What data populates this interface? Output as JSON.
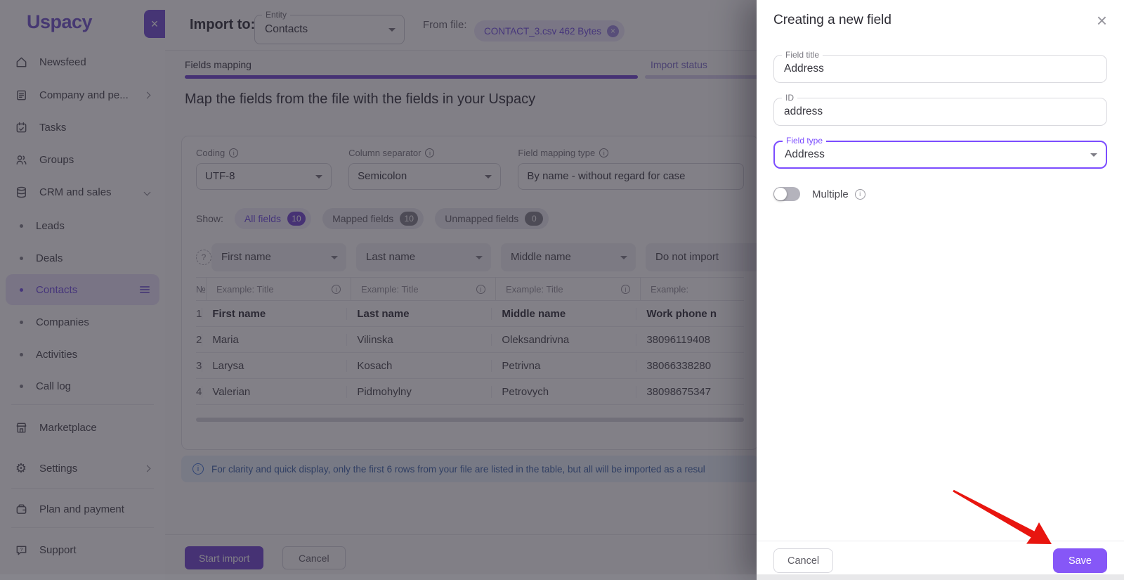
{
  "accent_color": "#7b52d6",
  "save_color": "#8657f7",
  "sidebar": {
    "logo": "Uspacy",
    "items": [
      {
        "label": "Newsfeed",
        "icon": "home-icon"
      },
      {
        "label": "Company and pe...",
        "icon": "building-icon"
      },
      {
        "label": "Tasks",
        "icon": "calendar-icon"
      },
      {
        "label": "Groups",
        "icon": "users-icon"
      },
      {
        "label": "CRM and sales",
        "icon": "database-icon"
      },
      {
        "label": "Leads"
      },
      {
        "label": "Deals"
      },
      {
        "label": "Contacts"
      },
      {
        "label": "Companies"
      },
      {
        "label": "Activities"
      },
      {
        "label": "Call log"
      },
      {
        "label": "Marketplace",
        "icon": "store-icon"
      },
      {
        "label": "Settings",
        "icon": "gear-icon"
      },
      {
        "label": "Plan and payment",
        "icon": "wallet-icon"
      },
      {
        "label": "Support",
        "icon": "help-chat-icon"
      }
    ]
  },
  "topbar": {
    "title": "Import to:",
    "entity_label": "Entity",
    "entity_value": "Contacts",
    "from_file_label": "From file:",
    "file_chip": "CONTACT_3.csv 462 Bytes"
  },
  "tabs": {
    "fields_mapping": "Fields mapping",
    "import_status": "Import status"
  },
  "heading": "Map the fields from the file with the fields in your Uspacy",
  "settings": {
    "coding_label": "Coding",
    "coding_value": "UTF-8",
    "separator_label": "Column separator",
    "separator_value": "Semicolon",
    "mapping_label": "Field mapping type",
    "mapping_value": "By name - without regard for case"
  },
  "filters": {
    "show_label": "Show:",
    "chips": [
      {
        "label": "All fields",
        "count": "10"
      },
      {
        "label": "Mapped fields",
        "count": "10"
      },
      {
        "label": "Unmapped fields",
        "count": "0"
      }
    ]
  },
  "table": {
    "column_selects": [
      "First name",
      "Last name",
      "Middle name",
      "Do not import"
    ],
    "row_number_header": "№",
    "example_placeholder": "Example: Title",
    "example_short": "Example:",
    "rows": [
      {
        "num": "1",
        "cells": [
          "First name",
          "Last name",
          "Middle name",
          "Work phone n"
        ]
      },
      {
        "num": "2",
        "cells": [
          "Maria",
          "Vilinska",
          "Oleksandrivna",
          "38096119408"
        ]
      },
      {
        "num": "3",
        "cells": [
          "Larysa",
          "Kosach",
          "Petrivna",
          "38066338280"
        ]
      },
      {
        "num": "4",
        "cells": [
          "Valerian",
          "Pidmohylny",
          "Petrovych",
          "38098675347"
        ]
      }
    ]
  },
  "banner": {
    "text": "For clarity and quick display, only the first 6 rows from your file are listed in the table, but all will be imported as a resul"
  },
  "footer": {
    "start_label": "Start import",
    "cancel_label": "Cancel"
  },
  "drawer": {
    "title": "Creating a new field",
    "field_title_label": "Field title",
    "field_title_value": "Address",
    "id_label": "ID",
    "id_value": "address",
    "field_type_label": "Field type",
    "field_type_value": "Address",
    "multiple_label": "Multiple",
    "multiple_enabled": false,
    "cancel_label": "Cancel",
    "save_label": "Save"
  },
  "icons": {
    "close": "×",
    "chip_remove": "×",
    "gear": "⚙",
    "question": "?",
    "info": "i"
  }
}
